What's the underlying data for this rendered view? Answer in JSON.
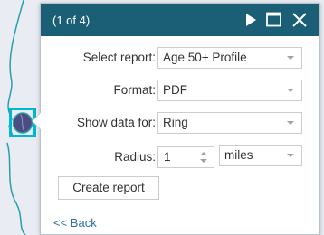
{
  "popup": {
    "title": "(1 of 4)",
    "controls": {
      "next_icon": "play-icon",
      "maximize_icon": "maximize-icon",
      "close_icon": "close-icon"
    }
  },
  "form": {
    "report_label": "Select report:",
    "report_value": "Age 50+ Profile",
    "format_label": "Format:",
    "format_value": "PDF",
    "show_data_label": "Show data for:",
    "show_data_value": "Ring",
    "radius_label": "Radius:",
    "radius_value": "1",
    "radius_unit": "miles"
  },
  "actions": {
    "create_label": "Create report",
    "back_label": "<< Back"
  },
  "colors": {
    "header": "#1b5f77",
    "marker": "#00b7d8",
    "map_line": "#2a9fa8",
    "link": "#2f72a3"
  }
}
